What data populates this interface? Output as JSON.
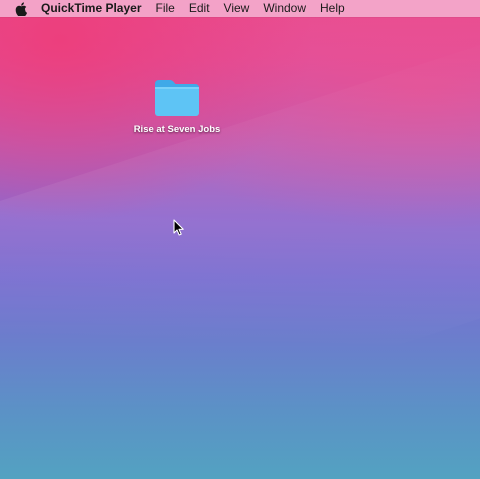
{
  "menubar": {
    "apple_icon": "apple-icon",
    "app_name": "QuickTime Player",
    "items": [
      "File",
      "Edit",
      "View",
      "Window",
      "Help"
    ]
  },
  "desktop": {
    "icons": [
      {
        "label": "Rise at Seven Jobs",
        "type": "folder-icon"
      }
    ]
  },
  "colors": {
    "folder": "#5ec4f5",
    "menubar": "#f3aacd",
    "wallpaper_top": "#ea4d8f",
    "wallpaper_mid": "#8f66cc",
    "wallpaper_bottom": "#53a2c1"
  }
}
